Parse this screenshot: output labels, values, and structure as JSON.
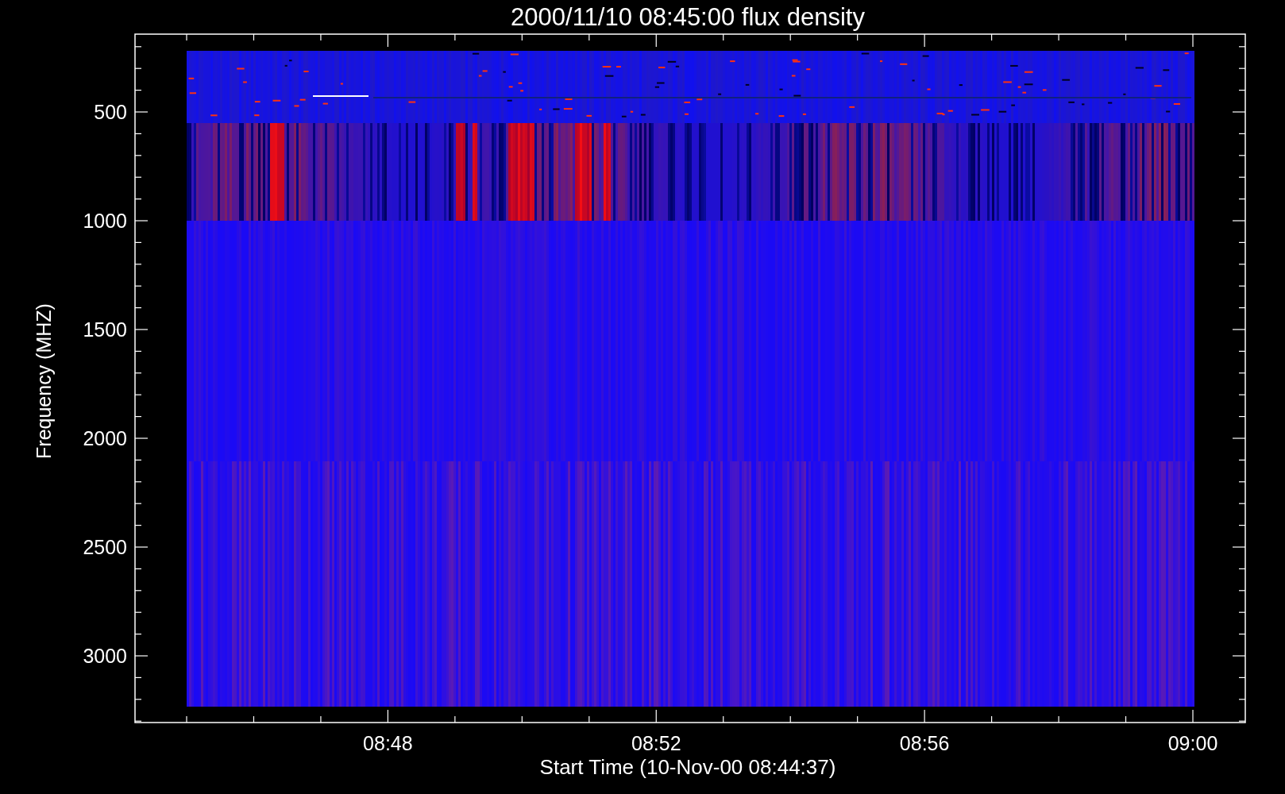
{
  "plot": {
    "title": "2000/11/10 08:45:00 flux density",
    "ylabel": "Frequency (MHZ)",
    "xlabel": "Start Time (10-Nov-00 08:44:37)",
    "yticks": [
      "500",
      "1000",
      "1500",
      "2000",
      "2500",
      "3000"
    ],
    "xticks": [
      "08:48",
      "08:52",
      "08:56",
      "09:00"
    ]
  }
}
